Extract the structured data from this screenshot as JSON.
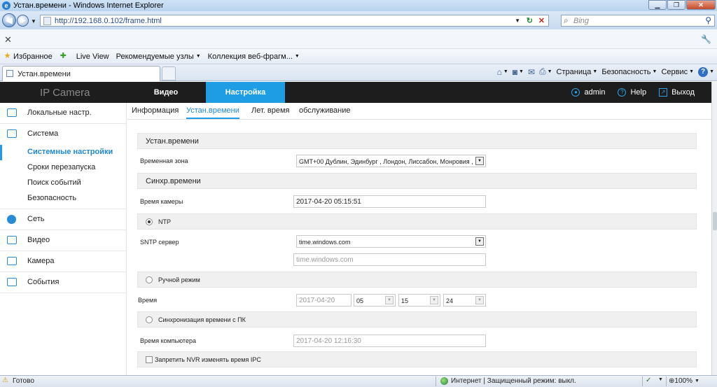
{
  "browser": {
    "window_title": "Устан.времени - Windows Internet Explorer",
    "address": "http://192.168.0.102/frame.html",
    "search_placeholder": "Bing",
    "favorites": {
      "label": "Избранное",
      "items": [
        "Live View",
        "Рекомендуемые узлы",
        "Коллекция веб-фрагм..."
      ]
    },
    "tab_title": "Устан.времени",
    "tools": [
      "Страница",
      "Безопасность",
      "Сервис"
    ]
  },
  "app": {
    "brand": "IP Camera",
    "nav": {
      "video": "Видео",
      "setup": "Настройка"
    },
    "user": "admin",
    "help": "Help",
    "logout": "Выход",
    "accent": "#1e9de5"
  },
  "sidebar": {
    "local": "Локальные настр.",
    "system": "Система",
    "system_items": [
      "Системные настройки",
      "Сроки перезапуска",
      "Поиск событий",
      "Безопасность"
    ],
    "network": "Сеть",
    "video": "Видео",
    "camera": "Камера",
    "events": "События"
  },
  "tabs": [
    "Информация",
    "Устан.времени",
    "Лет. время",
    "обслуживание"
  ],
  "form": {
    "section_time": "Устан.времени",
    "timezone_label": "Временная зона",
    "timezone_value": "GMT+00 Дублин, Эдинбург , Лондон, Лиссабон, Монровия ,",
    "section_sync": "Синхр.времени",
    "camera_time_label": "Время камеры",
    "camera_time_value": "2017-04-20 05:15:51",
    "ntp_label": "NTP",
    "sntp_label": "SNTP сервер",
    "sntp_value": "time.windows.com",
    "sntp_custom": "time.windows.com",
    "manual_label": "Ручной режим",
    "time_label": "Время",
    "manual_date": "2017-04-20",
    "manual_hour": "05",
    "manual_min": "15",
    "manual_sec": "24",
    "pc_sync_label": "Синхронизация времени с ПК",
    "pc_time_label": "Время компьютера",
    "pc_time_value": "2017-04-20 12:16:30",
    "nvr_label": "Запретить NVR изменять время IPC"
  },
  "status": {
    "done": "Готово",
    "zone": "Интернет | Защищенный режим: выкл.",
    "zoom": "100%"
  }
}
